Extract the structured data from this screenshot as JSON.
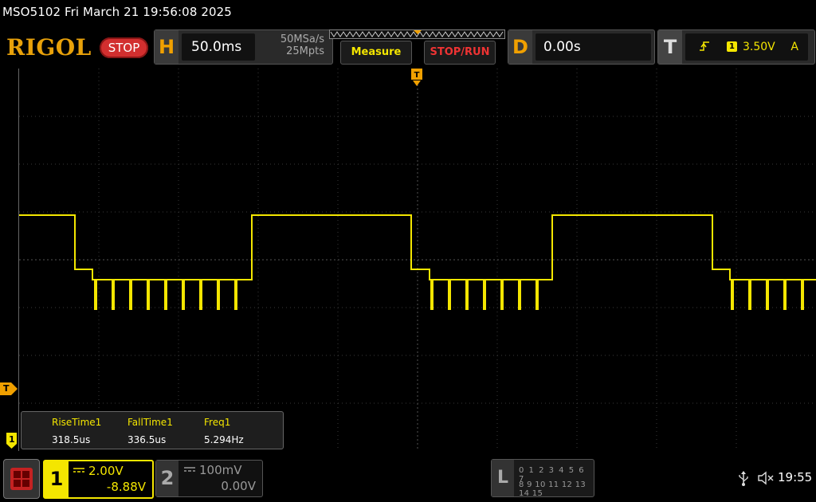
{
  "header": {
    "title_line": "MSO5102  Fri March 21 19:56:08 2025",
    "logo": "RIGOL",
    "run_state": "STOP"
  },
  "horizontal": {
    "letter": "H",
    "timebase": "50.0ms",
    "sample_rate": "50MSa/s",
    "memory_depth": "25Mpts"
  },
  "buttons": {
    "measure": "Measure",
    "stop_run": "STOP/RUN"
  },
  "delay": {
    "letter": "D",
    "value": "0.00s"
  },
  "trigger": {
    "letter": "T",
    "slope_icon": "rising-edge-icon",
    "source": "1",
    "level": "3.50V",
    "mode": "A"
  },
  "markers": {
    "trigger_level_marker": "T",
    "ch1_marker": "1"
  },
  "measurements": {
    "items": [
      {
        "name": "RiseTime1",
        "value": "318.5us"
      },
      {
        "name": "FallTime1",
        "value": "336.5us"
      },
      {
        "name": "Freq1",
        "value": "5.294Hz"
      }
    ]
  },
  "channels": {
    "ch1": {
      "number": "1",
      "scale": "2.00V",
      "offset": "-8.88V",
      "color": "#f4e600"
    },
    "ch2": {
      "number": "2",
      "scale": "100mV",
      "offset": "0.00V",
      "color": "#999999"
    }
  },
  "logic_analyzer": {
    "letter": "L",
    "row1": "0 1 2 3  4 5 6 7",
    "row2": "8 9 10 11 12 13 14 15"
  },
  "status": {
    "usb_icon": "usb-icon",
    "speaker_icon": "speaker-muted-icon",
    "time": "19:55"
  },
  "colors": {
    "brand": "#e8a10a",
    "trace": "#f4e600",
    "stop": "#d22f2f"
  }
}
